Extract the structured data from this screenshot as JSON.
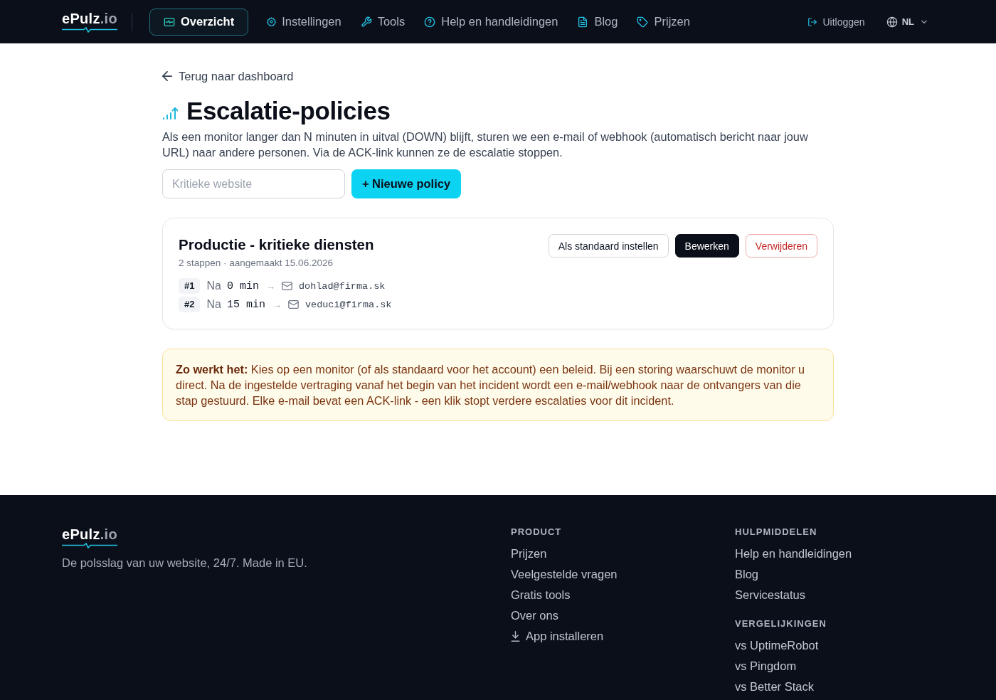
{
  "header": {
    "logo": {
      "name": "ePulz",
      "suffix": ".io"
    },
    "nav": [
      {
        "label": "Overzicht",
        "selected": true
      },
      {
        "label": "Instellingen",
        "selected": false
      },
      {
        "label": "Tools",
        "selected": false
      },
      {
        "label": "Help en handleidingen",
        "selected": false
      },
      {
        "label": "Blog",
        "selected": false
      },
      {
        "label": "Prijzen",
        "selected": false
      }
    ],
    "logout": "Uitloggen",
    "language": "NL"
  },
  "back_link": "Terug naar dashboard",
  "title": "Escalatie-policies",
  "description": "Als een monitor langer dan N minuten in uitval (DOWN) blijft, sturen we een e-mail of webhook (automatisch bericht naar jouw URL) naar andere personen. Via de ACK-link kunnen ze de escalatie stoppen.",
  "new_policy": {
    "placeholder": "Kritieke website",
    "button": "+ Nieuwe policy"
  },
  "policies": [
    {
      "name": "Productie - kritieke diensten",
      "meta": "2 stappen · aangemaakt 15.06.2026",
      "actions": [
        {
          "label": "Als standaard instellen",
          "kind": "outline"
        },
        {
          "label": "Bewerken",
          "kind": "primary"
        },
        {
          "label": "Verwijderen",
          "kind": "danger"
        }
      ],
      "steps": [
        {
          "number": "#1",
          "prefix": "Na",
          "delay": "0 min",
          "arrow": "→",
          "target": "dohlad@firma.sk"
        },
        {
          "number": "#2",
          "prefix": "Na",
          "delay": "15 min",
          "arrow": "→",
          "target": "veduci@firma.sk"
        }
      ]
    }
  ],
  "info": "**Zo werkt het:** Kies op een monitor (of als standaard voor het account) een beleid. Bij een storing waarschuwt de monitor u direct. Na de ingestelde vertraging vanaf het begin van het incident wordt een e-mail/webhook naar de ontvangers van die stap gestuurd. Elke e-mail bevat een ACK-link - een klik stopt verdere escalaties voor dit incident.",
  "footer": {
    "logo": {
      "name": "ePulz",
      "suffix": ".io"
    },
    "tagline": "De polsslag van uw website, 24/7. Made in EU.",
    "columns": [
      {
        "sections": [
          {
            "heading": "PRODUCT",
            "links": [
              {
                "label": "Prijzen",
                "kind": "link"
              },
              {
                "label": "Veelgestelde vragen",
                "kind": "link"
              },
              {
                "label": "Gratis tools",
                "kind": "link"
              },
              {
                "label": "Over ons",
                "kind": "link"
              },
              {
                "label": "App installeren",
                "kind": "download"
              }
            ]
          }
        ]
      },
      {
        "sections": [
          {
            "heading": "HULPMIDDELEN",
            "links": [
              {
                "label": "Help en handleidingen",
                "kind": "link"
              },
              {
                "label": "Blog",
                "kind": "link"
              },
              {
                "label": "Servicestatus",
                "kind": "link"
              }
            ]
          },
          {
            "heading": "VERGELIJKINGEN",
            "links": [
              {
                "label": "vs UptimeRobot",
                "kind": "link"
              },
              {
                "label": "vs Pingdom",
                "kind": "link"
              },
              {
                "label": "vs Better Stack",
                "kind": "link"
              }
            ]
          }
        ]
      }
    ]
  }
}
